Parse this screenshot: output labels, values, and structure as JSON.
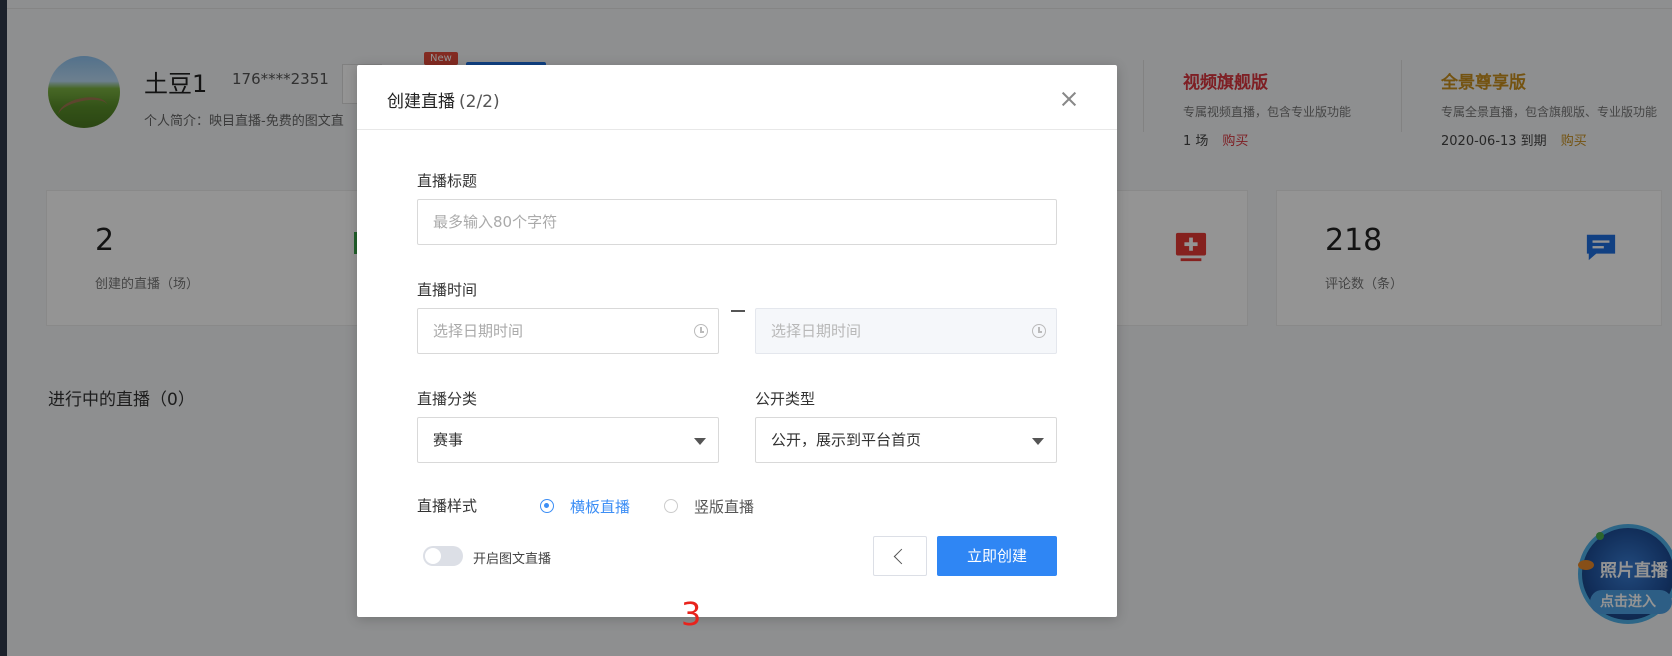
{
  "profile": {
    "username": "土豆1",
    "phone": "176****2351",
    "bio": "个人简介：映目直播-免费的图文直",
    "new_badge": "New"
  },
  "plans": [
    {
      "title": "视频旗舰版",
      "desc": "专属视频直播，包含专业版功能",
      "meta": "1 场",
      "buy": "购买",
      "color": "#d9363e"
    },
    {
      "title": "全景尊享版",
      "desc": "专属全景直播，包含旗舰版、专业版功能",
      "meta": "2020-06-13 到期",
      "buy": "购买",
      "color": "#c8901e"
    }
  ],
  "stats": [
    {
      "value": "2",
      "label": "创建的直播（场）"
    },
    {
      "value": "218",
      "label": "评论数（条）"
    }
  ],
  "ongoing": {
    "title": "进行中的直播（0）"
  },
  "float_widget": {
    "line1": "照片直播",
    "line2": "点击进入"
  },
  "modal": {
    "title": "创建直播",
    "step": "(2/2)",
    "title_label": "直播标题",
    "title_placeholder": "最多输入80个字符",
    "time_label": "直播时间",
    "start_placeholder": "选择日期时间",
    "end_placeholder": "选择日期时间",
    "category_label": "直播分类",
    "category_value": "赛事",
    "public_label": "公开类型",
    "public_value": "公开，展示到平台首页",
    "style_label": "直播样式",
    "style_options": [
      "横板直播",
      "竖版直播"
    ],
    "style_selected": "横板直播",
    "toggle_label": "开启图文直播",
    "toggle_on": false,
    "create_button": "立即创建"
  },
  "annotation": "3",
  "colors": {
    "primary": "#2f86f4",
    "annotation": "#e8231c"
  },
  "icons": [
    "close-icon",
    "clock-icon",
    "chevron-down-icon",
    "chevron-left-icon",
    "add-live-icon",
    "comment-icon"
  ]
}
